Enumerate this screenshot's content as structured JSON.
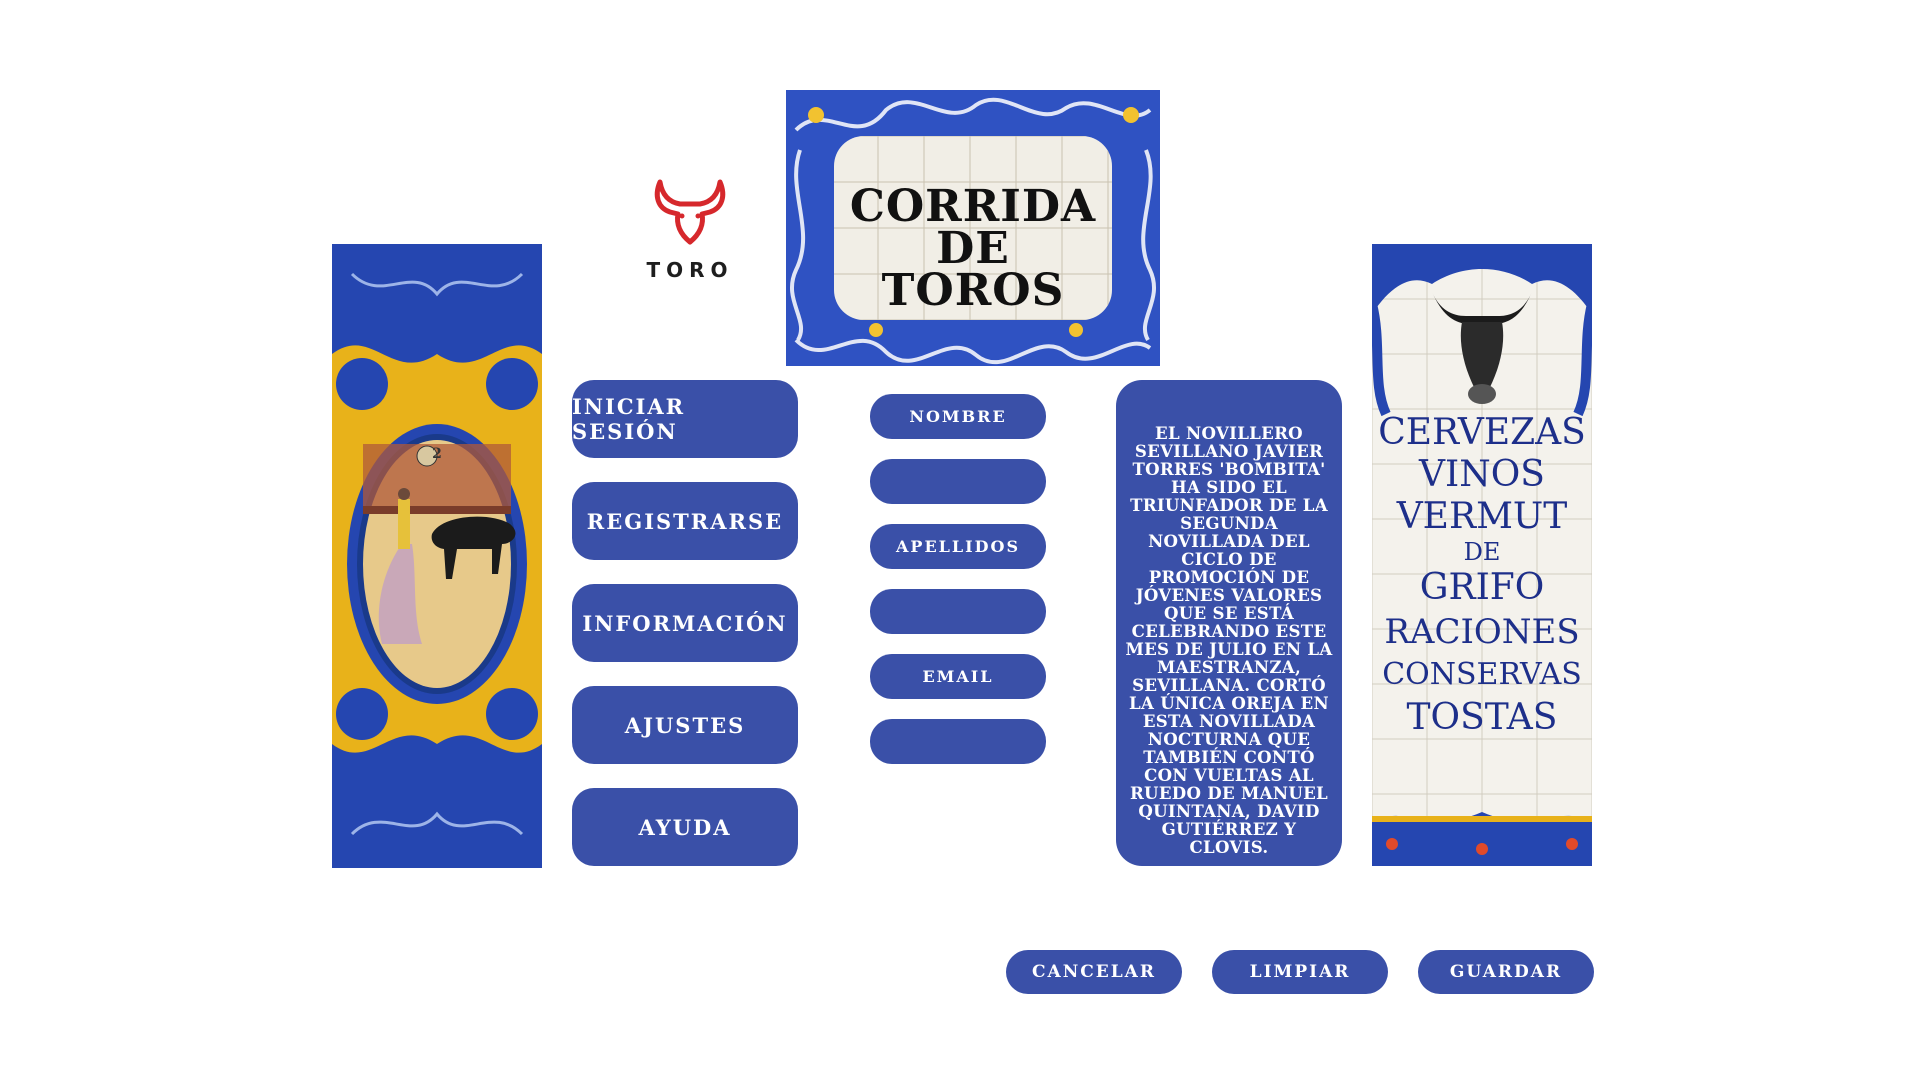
{
  "logo": {
    "text": "TORO",
    "icon": "bull-head-icon",
    "color": "#d6282c"
  },
  "banner": {
    "title_line1": "CORRIDA DE",
    "title_line2": "TOROS"
  },
  "menu": [
    {
      "label": "INICIAR  SESIÓN"
    },
    {
      "label": "REGISTRARSE"
    },
    {
      "label": "INFORMACIÓN"
    },
    {
      "label": "AJUSTES"
    },
    {
      "label": "AYUDA"
    }
  ],
  "form": {
    "nombre_label": "NOMBRE",
    "nombre_value": "",
    "apellidos_label": "APELLIDOS",
    "apellidos_value": "",
    "email_label": "EMAIL",
    "email_value": ""
  },
  "info": {
    "text": "El novillero sevillano Javier Torres 'Bombita' ha sido el triunfador de la segunda novillada del ciclo de promoción de jóvenes valores que se está celebrando este mes de julio en la Maestranza, Sevillana. Cortó la única oreja en esta novillada nocturna que también contó con vueltas al ruedo de Manuel Quintana, David Gutiérrez y Clovis."
  },
  "sign": {
    "lines": [
      "CERVEZAS",
      "VINOS",
      "VERMUT",
      "DE",
      "GRIFO",
      "RACIONES",
      "CONSERVAS",
      "TOSTAS"
    ],
    "icon": "bull-head-icon"
  },
  "left_panel": {
    "number": "2",
    "icon": "bullfight-scene-icon"
  },
  "actions": {
    "cancel": "CANCELAR",
    "clear": "LIMPIAR",
    "save": "GUARDAR"
  },
  "colors": {
    "primary": "#3a50a8",
    "tile_blue": "#2546b0",
    "tile_yellow": "#e8b21a",
    "logo_red": "#d6282c"
  }
}
